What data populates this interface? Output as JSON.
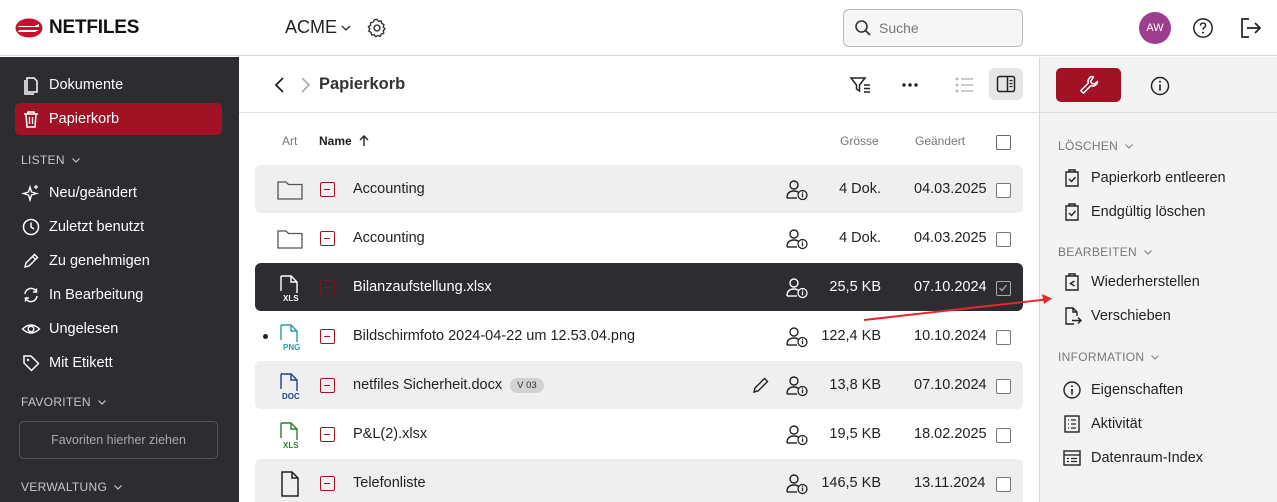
{
  "brand": {
    "name": "NETFILES"
  },
  "header": {
    "tenant": "ACME",
    "search_placeholder": "Suche",
    "avatar_initials": "AW"
  },
  "sidebar": {
    "items": [
      {
        "label": "Dokumente",
        "icon": "documents-icon"
      },
      {
        "label": "Papierkorb",
        "icon": "trash-icon",
        "active": true
      }
    ],
    "listen_label": "LISTEN",
    "listen_items": [
      {
        "label": "Neu/geändert",
        "icon": "sparkle-icon"
      },
      {
        "label": "Zuletzt benutzt",
        "icon": "clock-icon"
      },
      {
        "label": "Zu genehmigen",
        "icon": "pencil-icon"
      },
      {
        "label": "In Bearbeitung",
        "icon": "sync-icon"
      },
      {
        "label": "Ungelesen",
        "icon": "eye-icon"
      },
      {
        "label": "Mit Etikett",
        "icon": "tag-icon"
      }
    ],
    "favoriten_label": "FAVORITEN",
    "favoriten_drop": "Favoriten hierher ziehen",
    "verwaltung_label": "VERWALTUNG"
  },
  "main": {
    "breadcrumb": "Papierkorb",
    "columns": {
      "art": "Art",
      "name": "Name",
      "size": "Grösse",
      "changed": "Geändert"
    },
    "rows": [
      {
        "type": "folder",
        "name": "Accounting",
        "size": "4 Dok.",
        "date": "04.03.2025",
        "shaded": true
      },
      {
        "type": "folder",
        "name": "Accounting",
        "size": "4 Dok.",
        "date": "04.03.2025"
      },
      {
        "type": "xls",
        "name": "Bilanzaufstellung.xlsx",
        "size": "25,5 KB",
        "date": "07.10.2024",
        "selected": true
      },
      {
        "type": "png",
        "name": "Bildschirmfoto 2024-04-22 um 12.53.04.png",
        "size": "122,4 KB",
        "date": "10.10.2024",
        "unread": true
      },
      {
        "type": "doc",
        "name": "netfiles Sicherheit.docx",
        "version": "V 03",
        "size": "13,8 KB",
        "date": "07.10.2024",
        "shaded": true,
        "editing": true
      },
      {
        "type": "xls",
        "name": "P&L(2).xlsx",
        "size": "19,5 KB",
        "date": "18.02.2025"
      },
      {
        "type": "file",
        "name": "Telefonliste",
        "size": "146,5 KB",
        "date": "13.11.2024",
        "shaded": true
      }
    ],
    "file_labels": {
      "xls": "XLS",
      "png": "PNG",
      "doc": "DOC"
    }
  },
  "panel": {
    "sections": [
      {
        "label": "LÖSCHEN",
        "items": [
          "Papierkorb entleeren",
          "Endgültig löschen"
        ]
      },
      {
        "label": "BEARBEITEN",
        "items": [
          "Wiederherstellen",
          "Verschieben"
        ]
      },
      {
        "label": "INFORMATION",
        "items": [
          "Eigenschaften",
          "Aktivität",
          "Datenraum-Index"
        ]
      }
    ]
  },
  "colors": {
    "accent": "#a11224",
    "sidebar": "#2c2c31",
    "avatar": "#9d3d8e",
    "annotation_arrow": "#e8262b"
  }
}
